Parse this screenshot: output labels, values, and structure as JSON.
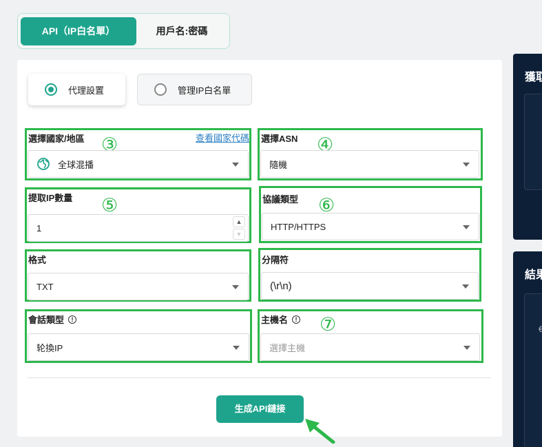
{
  "tabs": {
    "api_label": "API（IP白名單）",
    "userpass_label": "用戶名:密碼"
  },
  "modes": {
    "proxy_settings": "代理設置",
    "manage_whitelist": "管理IP白名單"
  },
  "fields": {
    "country": {
      "label": "選擇國家/地區",
      "link": "查看國家代碼",
      "value": "全球混播",
      "badge": "③"
    },
    "asn": {
      "label": "選擇ASN",
      "value": "隨機",
      "badge": "④"
    },
    "quantity": {
      "label": "提取IP數量",
      "value": "1",
      "badge": "⑤"
    },
    "protocol": {
      "label": "協議類型",
      "value": "HTTP/HTTPS",
      "badge": "⑥"
    },
    "format": {
      "label": "格式",
      "value": "TXT"
    },
    "separator": {
      "label": "分隔符",
      "value": "(\\r\\n)"
    },
    "session": {
      "label": "會話類型",
      "value": "轮換IP"
    },
    "hostname": {
      "label": "主機名",
      "placeholder": "選擇主機",
      "badge": "⑦"
    }
  },
  "generate_button": "生成API鏈接",
  "right_panels": {
    "top_title": "獲取",
    "bottom_title": "結果",
    "glyph": "€"
  },
  "colors": {
    "accent": "#1ea48d",
    "highlight": "#2db84b",
    "dark_panel": "#0d1f37",
    "link": "#2b7fc4"
  }
}
